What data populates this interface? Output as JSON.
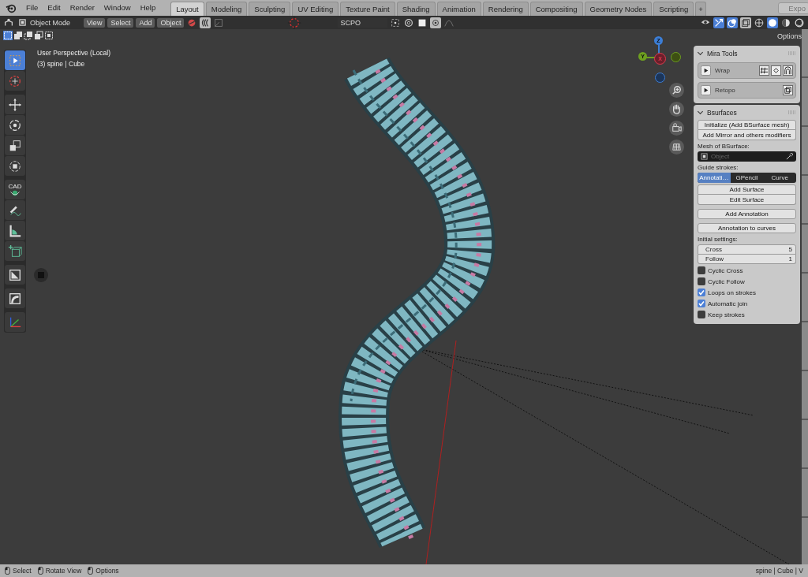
{
  "app_menu": [
    "File",
    "Edit",
    "Render",
    "Window",
    "Help"
  ],
  "workspace_tabs": [
    {
      "label": "Layout",
      "selected": true
    },
    {
      "label": "Modeling",
      "selected": false
    },
    {
      "label": "Sculpting",
      "selected": false
    },
    {
      "label": "UV Editing",
      "selected": false
    },
    {
      "label": "Texture Paint",
      "selected": false
    },
    {
      "label": "Shading",
      "selected": false
    },
    {
      "label": "Animation",
      "selected": false
    },
    {
      "label": "Rendering",
      "selected": false
    },
    {
      "label": "Compositing",
      "selected": false
    },
    {
      "label": "Geometry Nodes",
      "selected": false
    },
    {
      "label": "Scripting",
      "selected": false
    }
  ],
  "add_tab": "+",
  "export_button": "Expo",
  "header": {
    "mode": "Object Mode",
    "menus": [
      "View",
      "Select",
      "Add",
      "Object"
    ],
    "pivot": "SCPO",
    "options": "Options"
  },
  "tools": [
    {
      "kind": "select",
      "selected": true
    },
    {
      "kind": "cursor",
      "selected": false
    },
    {
      "kind": "move",
      "selected": false
    },
    {
      "kind": "rotate",
      "selected": false
    },
    {
      "kind": "scale",
      "selected": false
    },
    {
      "kind": "transform",
      "selected": false
    },
    {
      "kind": "cad",
      "label": "CAD",
      "selected": false
    },
    {
      "kind": "annotate",
      "selected": false
    },
    {
      "kind": "measure",
      "selected": false
    },
    {
      "kind": "add-cube",
      "selected": false
    },
    {
      "kind": "shear",
      "selected": false
    },
    {
      "kind": "bend",
      "selected": false
    },
    {
      "kind": "axes",
      "selected": false
    }
  ],
  "viewport": {
    "title": "User Perspective (Local)",
    "subtitle": "(3) spine | Cube"
  },
  "gizmo": {
    "x": "X",
    "y": "Y",
    "z": "Z"
  },
  "sidebar": {
    "mira": {
      "title": "Mira Tools",
      "items": [
        {
          "label": "Wrap",
          "kind": "wrap"
        },
        {
          "label": "Retopo",
          "kind": "retopo"
        }
      ]
    },
    "bsurfaces": {
      "title": "Bsurfaces",
      "init_buttons": [
        "Initialize (Add BSurface mesh)",
        "Add Mirror and others modifiers"
      ],
      "mesh_label": "Mesh of BSurface:",
      "mesh_field": {
        "placeholder": "Object"
      },
      "guide_label": "Guide strokes:",
      "guide_options": [
        {
          "label": "Annotati…",
          "selected": true
        },
        {
          "label": "GPencil",
          "selected": false
        },
        {
          "label": "Curve",
          "selected": false
        }
      ],
      "surface_buttons": [
        "Add Surface",
        "Edit Surface"
      ],
      "annotation_buttons": [
        "Add Annotation",
        "Annotation to curves"
      ],
      "initial_label": "Initial settings:",
      "settings": [
        {
          "label": "Cross",
          "value": "5"
        },
        {
          "label": "Follow",
          "value": "1"
        }
      ],
      "checkboxes": [
        {
          "label": "Cyclic Cross",
          "checked": false
        },
        {
          "label": "Cyclic Follow",
          "checked": false
        },
        {
          "label": "Loops on strokes",
          "checked": true
        },
        {
          "label": "Automatic join",
          "checked": true
        },
        {
          "label": "Keep strokes",
          "checked": false
        }
      ]
    }
  },
  "status_bar": {
    "hints": [
      "Select",
      "Rotate View",
      "Options"
    ],
    "info": "spine | Cube | V"
  }
}
